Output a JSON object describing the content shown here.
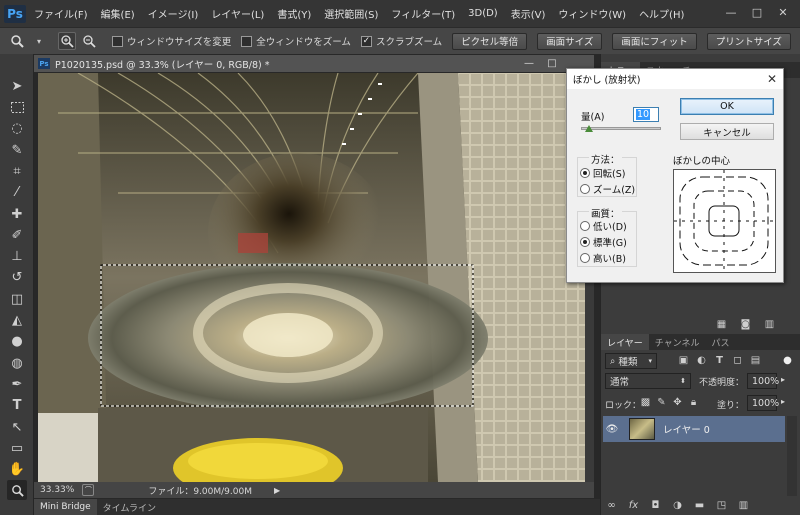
{
  "app": {
    "logo": "Ps",
    "menus": [
      "ファイル(F)",
      "編集(E)",
      "イメージ(I)",
      "レイヤー(L)",
      "書式(Y)",
      "選択範囲(S)",
      "フィルター(T)",
      "3D(D)",
      "表示(V)",
      "ウィンドウ(W)",
      "ヘルプ(H)"
    ],
    "window_controls": {
      "minimize": "—",
      "maximize": "□",
      "close": "✕"
    }
  },
  "options_bar": {
    "tool_icon": "zoom-icon",
    "check_resize_windows": "ウィンドウサイズを変更",
    "check_zoom_all": "全ウィンドウをズーム",
    "check_scrubby": "スクラブズーム",
    "check_resize_checked": false,
    "check_zoom_all_checked": false,
    "check_scrubby_checked": true,
    "btn_actual_pixels": "ピクセル等倍",
    "btn_screen_size": "画面サイズ",
    "btn_fit_screen": "画面にフィット",
    "btn_print_size": "プリントサイズ"
  },
  "document": {
    "tab_title": "P1020135.psd @ 33.3% (レイヤー 0, RGB/8) *",
    "psd_badge": "Ps",
    "zoom": "33.33%",
    "file_info": "ファイル：9.00M/9.00M"
  },
  "bottom_tabs": [
    "Mini Bridge",
    "タイムライン"
  ],
  "dialog": {
    "title": "ぼかし (放射状)",
    "amount_label": "量(A)",
    "amount_value": "10",
    "amount_fraction": 0.1,
    "ok": "OK",
    "cancel": "キャンセル",
    "method_label": "方法：",
    "method_spin": "回転(S)",
    "method_zoom": "ズーム(Z)",
    "quality_label": "画質：",
    "quality_draft": "低い(D)",
    "quality_good": "標準(G)",
    "quality_best": "高い(B)",
    "center_label": "ぼかしの中心"
  },
  "panels": {
    "top_tabs": [
      "カラー",
      "スウォッチ"
    ],
    "layers_tabs": [
      "レイヤー",
      "チャンネル",
      "パス"
    ],
    "filter_kind": "種類",
    "blend_mode": "通常",
    "opacity_label": "不透明度：",
    "opacity_value": "100%",
    "lock_label": "ロック：",
    "fill_label": "塗り：",
    "fill_value": "100%",
    "layer_name": "レイヤー 0"
  },
  "colors": {
    "accent": "#4a6fa5",
    "selected_layer": "#5b6f8f"
  }
}
